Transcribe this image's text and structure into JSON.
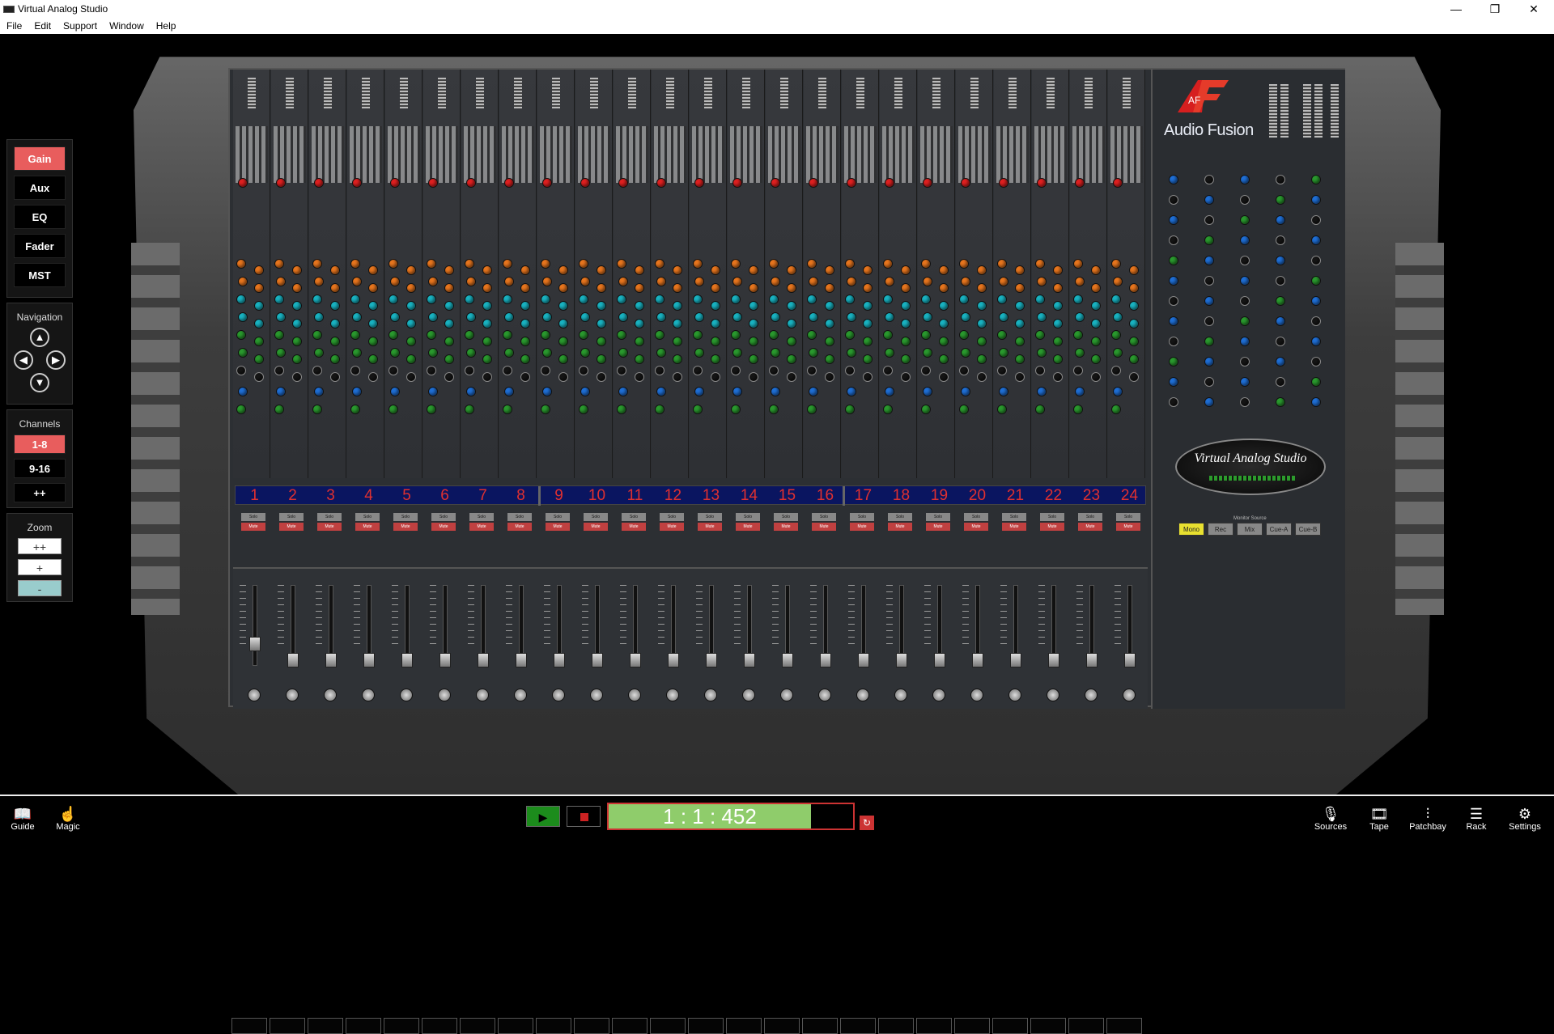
{
  "window": {
    "title": "Virtual Analog Studio",
    "controls": {
      "minimize": "—",
      "maximize": "❐",
      "close": "✕"
    }
  },
  "menu": [
    "File",
    "Edit",
    "Support",
    "Window",
    "Help"
  ],
  "left_panel": {
    "views": [
      {
        "label": "Gain",
        "active": true
      },
      {
        "label": "Aux",
        "active": false
      },
      {
        "label": "EQ",
        "active": false
      },
      {
        "label": "Fader",
        "active": false
      },
      {
        "label": "MST",
        "active": false
      }
    ],
    "navigation_title": "Navigation",
    "channels_title": "Channels",
    "channel_groups": [
      {
        "label": "1-8",
        "active": true
      },
      {
        "label": "9-16",
        "active": false
      },
      {
        "label": "++",
        "active": false
      }
    ],
    "zoom_title": "Zoom",
    "zoom": [
      {
        "label": "++",
        "active": false
      },
      {
        "label": "+",
        "active": false
      },
      {
        "label": "-",
        "active": true
      }
    ]
  },
  "console": {
    "channels": [
      "1",
      "2",
      "3",
      "4",
      "5",
      "6",
      "7",
      "8",
      "9",
      "10",
      "11",
      "12",
      "13",
      "14",
      "15",
      "16",
      "17",
      "18",
      "19",
      "20",
      "21",
      "22",
      "23",
      "24"
    ],
    "solo_label": "Solo",
    "mute_label": "Mute",
    "brand": "Audio Fusion",
    "logo_text": "AF",
    "badge": "Virtual Analog Studio",
    "monitor_source_title": "Monitor Source",
    "monitor_sources": [
      {
        "label": "Mono",
        "active": true
      },
      {
        "label": "Rec",
        "active": false
      },
      {
        "label": "Mix",
        "active": false
      },
      {
        "label": "Cue-A",
        "active": false
      },
      {
        "label": "Cue-B",
        "active": false
      }
    ],
    "colors": {
      "red": "#e02020",
      "orange": "#e8761e",
      "teal": "#19b3c2",
      "green": "#2a9a2e",
      "blue": "#1f6fd6"
    }
  },
  "transport": {
    "timecode": "1 : 1 : 452",
    "play_icon": "▶",
    "loop_icon": "↻"
  },
  "bottom_left": [
    {
      "label": "Guide",
      "icon": "📖"
    },
    {
      "label": "Magic",
      "icon": "☝"
    }
  ],
  "bottom_right": [
    {
      "label": "Sources",
      "icon": "🎙"
    },
    {
      "label": "Tape",
      "icon": "🎞"
    },
    {
      "label": "Patchbay",
      "icon": "⫶"
    },
    {
      "label": "Rack",
      "icon": "☰"
    },
    {
      "label": "Settings",
      "icon": "⚙"
    }
  ]
}
